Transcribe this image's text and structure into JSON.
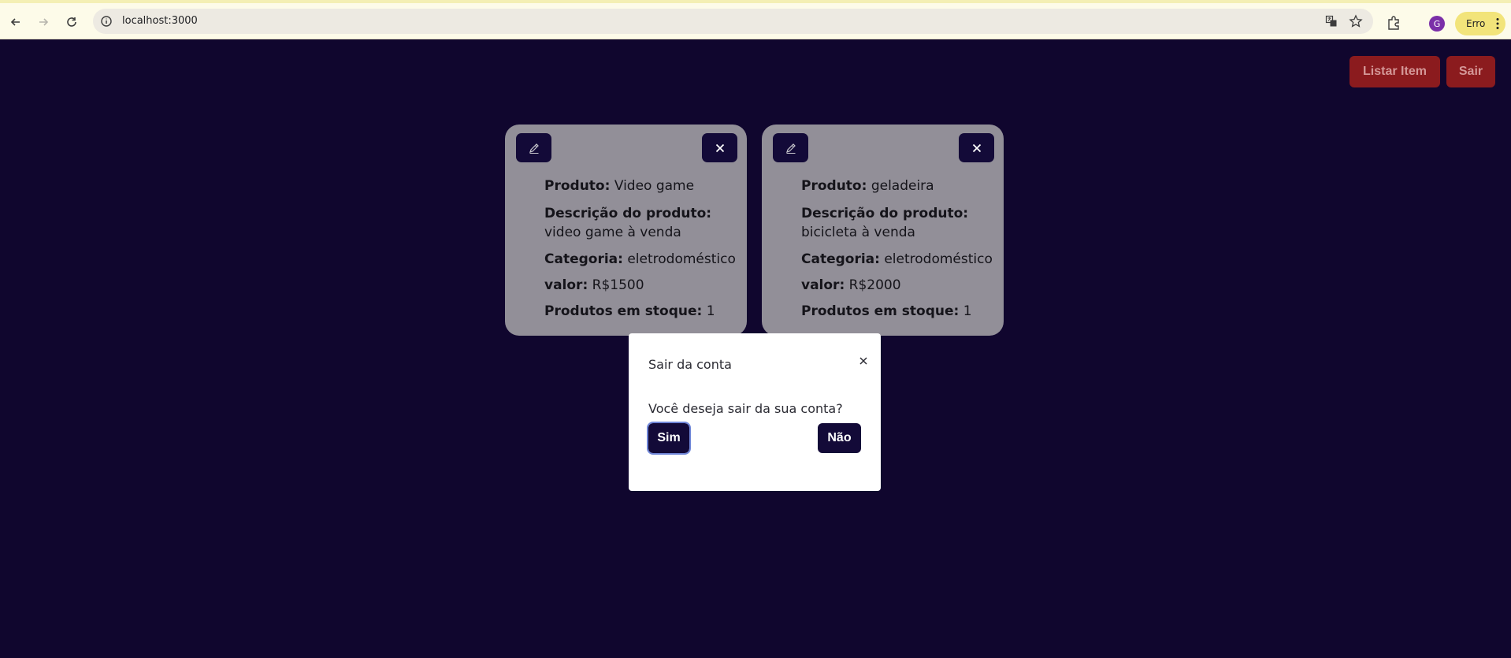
{
  "browser": {
    "url": "localhost:3000",
    "profile_initial": "G",
    "status_label": "Erro"
  },
  "header": {
    "list_item_label": "Listar Item",
    "logout_label": "Sair"
  },
  "products": [
    {
      "product_label": "Produto:",
      "product_value": "Video game",
      "description_label": "Descrição do produto:",
      "description_value": "video game à venda",
      "category_label": "Categoria:",
      "category_value": "eletrodoméstico",
      "price_label": "valor:",
      "price_value": "R$1500",
      "stock_label": "Produtos em stoque:",
      "stock_value": "1"
    },
    {
      "product_label": "Produto:",
      "product_value": "geladeira",
      "description_label": "Descrição do produto:",
      "description_value": "bicicleta à venda",
      "category_label": "Categoria:",
      "category_value": "eletrodoméstico",
      "price_label": "valor:",
      "price_value": "R$2000",
      "stock_label": "Produtos em stoque:",
      "stock_value": "1"
    }
  ],
  "modal": {
    "title": "Sair da conta",
    "message": "Você deseja sair da sua conta?",
    "confirm_label": "Sim",
    "cancel_label": "Não"
  },
  "colors": {
    "page_bg": "#10062e",
    "accent_red": "#8b1b1e",
    "card_bg": "#928f98",
    "dark_btn": "#130a38"
  }
}
